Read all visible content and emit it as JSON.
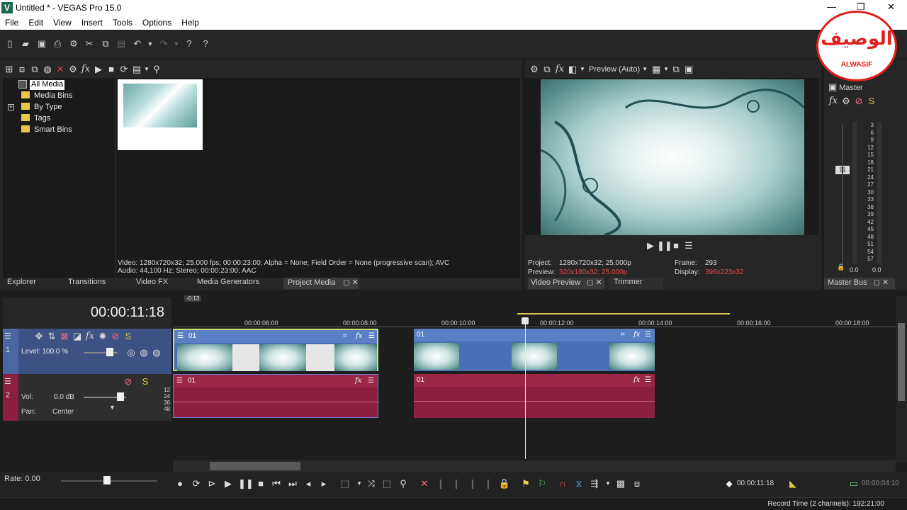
{
  "window": {
    "title": "Untitled * - VEGAS Pro 15.0",
    "controls": [
      "—",
      "❐",
      "✕"
    ]
  },
  "menu": [
    "File",
    "Edit",
    "View",
    "Insert",
    "Tools",
    "Options",
    "Help"
  ],
  "explorer": {
    "tree": [
      "All Media",
      "Media Bins",
      "By Type",
      "Tags",
      "Smart Bins"
    ],
    "selected": "All Media",
    "info_line1": "Video: 1280x720x32; 25.000 fps; 00:00:23:00; Alpha = None; Field Order = None (progressive scan); AVC",
    "info_line2": "Audio: 44,100 Hz; Stereo; 00:00:23:00; AAC"
  },
  "panel_tabs": [
    "Explorer",
    "Transitions",
    "Video FX",
    "Media Generators",
    "Project Media"
  ],
  "preview": {
    "mode": "Preview (Auto)",
    "project_label": "Project:",
    "project_value": "1280x720x32; 25.000p",
    "preview_label": "Preview:",
    "preview_value": "320x180x32; 25.000p",
    "frame_label": "Frame:",
    "frame_value": "293",
    "display_label": "Display:",
    "display_value": "396x223x32",
    "tabs": [
      "Video Preview",
      "Trimmer"
    ]
  },
  "master": {
    "label": "Master",
    "tab": "Master Bus",
    "scale": [
      "3",
      "6",
      "9",
      "12",
      "15",
      "18",
      "21",
      "24",
      "27",
      "30",
      "33",
      "36",
      "39",
      "42",
      "45",
      "48",
      "51",
      "54",
      "57"
    ],
    "peak_left": "0.0",
    "peak_right": "0.0"
  },
  "timeline": {
    "timecode": "00:00:11:18",
    "marker": "-0:13",
    "ruler": [
      "00:00:06:00",
      "00:00:08:00",
      "00:00:10:00",
      "00:00:12:00",
      "00:00:14:00",
      "00:00:16:00",
      "00:00:18:00"
    ],
    "video_track": {
      "number": "1",
      "level": "Level: 100.0 %",
      "clips": [
        "01",
        "01"
      ]
    },
    "audio_track": {
      "number": "2",
      "vol_label": "Vol:",
      "vol_value": "0.0 dB",
      "pan_label": "Pan:",
      "pan_value": "Center",
      "db_scale": [
        "12",
        "24",
        "36",
        "48"
      ],
      "clips": [
        "01",
        "01"
      ]
    }
  },
  "transport": {
    "rate": "Rate: 0.00",
    "cursor_time": "00:00:11:18",
    "selection_time": "00:00:04:10"
  },
  "status": {
    "record_time": "Record Time (2 channels): 192:21:00"
  },
  "watermark": {
    "arabic": "الوصيف",
    "latin": "ALWASIF",
    "color": "#e0201b"
  },
  "colors": {
    "video_clip": "#4b6eb5",
    "audio_clip": "#8c1f3f",
    "accent_red": "#e0201b"
  }
}
